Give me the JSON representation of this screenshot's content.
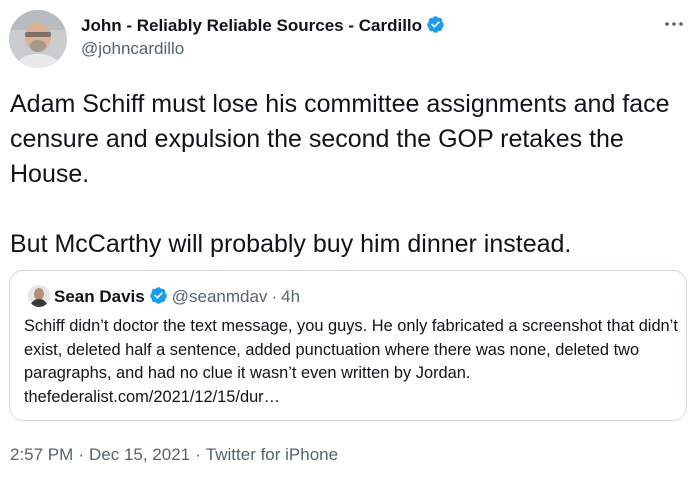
{
  "author": {
    "name": "John - Reliably Reliable Sources - Cardillo",
    "handle": "@johncardillo",
    "verified": true
  },
  "tweet": {
    "paragraphs": [
      "Adam Schiff must lose his committee assignments and face censure and expulsion the second the GOP retakes the House.",
      "But McCarthy will probably buy him dinner instead."
    ]
  },
  "quoted_tweet": {
    "name": "Sean Davis",
    "verified": true,
    "handle": "@seanmdav",
    "separator": "·",
    "age": "4h",
    "text": "Schiff didn’t doctor the text message, you guys. He only fabricated a screenshot that didn’t exist, deleted half a sentence, added punctuation where there was none, deleted two paragraphs, and had no clue it wasn’t even written by Jordan.",
    "link": "thefederalist.com/2021/12/15/dur…"
  },
  "footer": {
    "time": "2:57 PM",
    "separator": "·",
    "date": "Dec 15, 2021",
    "source": "Twitter for iPhone"
  },
  "icons": {
    "verified": "verified-badge-icon",
    "more": "more-options-icon"
  },
  "colors": {
    "text": "#0f1419",
    "secondary": "#536471",
    "verified": "#1d9bf0",
    "border": "#cfd9de"
  }
}
